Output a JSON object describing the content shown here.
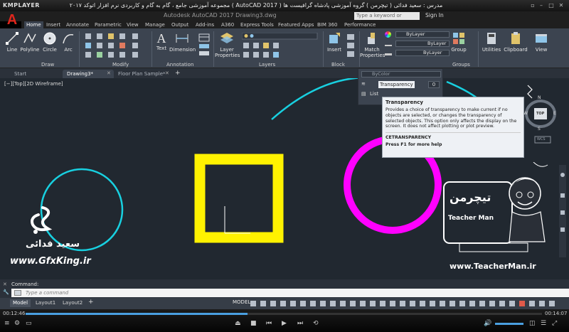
{
  "player": {
    "brand": "KMPLAYER",
    "title": "مجموعه آموزشی جامع ، گام به گام و کاربردی نرم افزار اتوکد ۲۰۱۷ ( AutoCAD 2017 )  مدرس : سعید فدائی ( تیچرمن ) گروه آموزشی پادشاه گرافیست ها",
    "time_current": "00:12:46",
    "time_total": "00:14:07",
    "progress_percent": 43
  },
  "acad": {
    "window_title": "Autodesk AutoCAD 2017   Drawing3.dwg",
    "search_placeholder": "Type a keyword or phrase",
    "sign_in": "Sign In",
    "tabs": [
      "Home",
      "Insert",
      "Annotate",
      "Parametric",
      "View",
      "Manage",
      "Output",
      "Add-ins",
      "A360",
      "Express Tools",
      "Featured Apps",
      "BIM 360",
      "Performance"
    ],
    "tools": {
      "line": "Line",
      "polyline": "Polyline",
      "circle": "Circle",
      "arc": "Arc",
      "text": "Text",
      "dimension": "Dimension",
      "layer_properties": "Layer Properties",
      "insert": "Insert",
      "match_properties": "Match Properties",
      "group": "Group",
      "utilities": "Utilities",
      "clipboard": "Clipboard",
      "view": "View"
    },
    "panels": [
      "Draw",
      "Modify",
      "Annotation",
      "Layers",
      "Block",
      "Groups"
    ],
    "properties": {
      "color": "ByLayer",
      "linetype": "ByLayer",
      "lineweight": "ByLayer",
      "bycolor": "ByColor",
      "transparency_label": "Transparency",
      "transparency_value": "0",
      "list": "List"
    },
    "doc_tabs": [
      "Start",
      "Drawing3*",
      "Floor Plan Sample*"
    ],
    "viewport_label": "[−][Top][2D Wireframe]",
    "viewcube": {
      "n": "N",
      "s": "S",
      "w": "W",
      "e": "E",
      "top": "TOP",
      "wcs": "WCS"
    },
    "tooltip": {
      "title": "Transparency",
      "desc": "Provides a choice of transparency to make current if no objects are selected, or changes the transparency of selected objects. This option only affects the display on the screen. It does not affect plotting or plot preview.",
      "command": "CETRANSPARENCY",
      "help": "Press F1 for more help"
    },
    "command_history": "Command:",
    "command_placeholder": "Type a command",
    "layout_tabs": [
      "Model",
      "Layout1",
      "Layout2"
    ],
    "status_model": "MODEL"
  },
  "watermarks": {
    "author_fa": "سعید فدائی",
    "site_left": "www.GfxKing.ir",
    "brand_fa": "تیچرمن",
    "brand_en": "Teacher Man",
    "site_right": "www.TeacherMan.ir"
  },
  "colors": {
    "cyan": "#18d0e0",
    "yellow": "#fff200",
    "magenta": "#ff00ff",
    "canvas": "#212830"
  }
}
